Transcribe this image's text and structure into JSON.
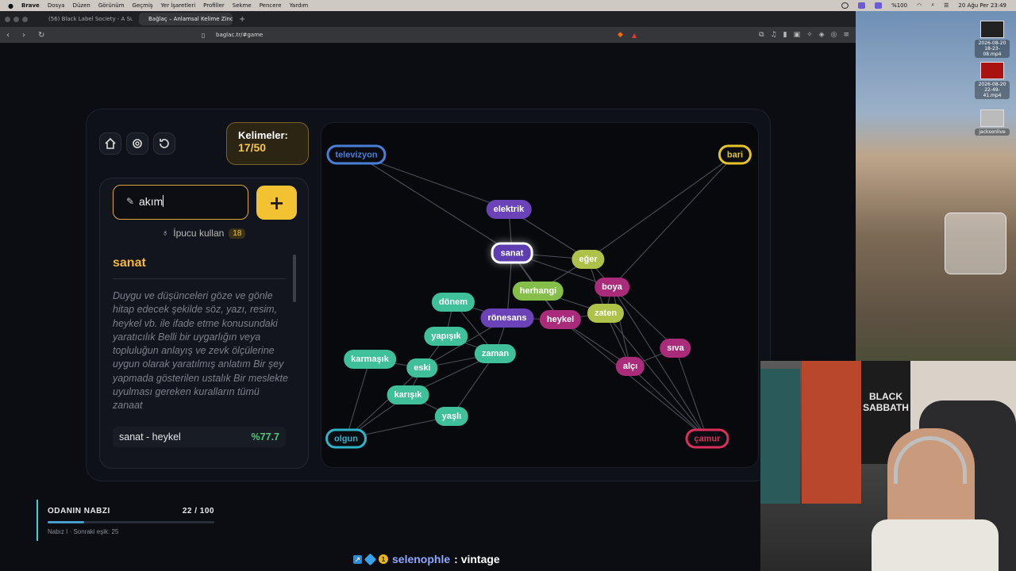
{
  "menubar": {
    "app": "Brave",
    "items": [
      "Dosya",
      "Düzen",
      "Görünüm",
      "Geçmiş",
      "Yer İşaretleri",
      "Profiller",
      "Sekme",
      "Pencere",
      "Yardım"
    ],
    "battery": "%100",
    "datetime": "20 Ağu Per  23:49"
  },
  "browser": {
    "tabs": [
      {
        "label": "(56) Black Label Society - A Su"
      },
      {
        "label": "Bağlaç – Anlamsal Kelime Zinc"
      }
    ],
    "url": "baglac.tr/#game"
  },
  "desktop": {
    "files": [
      {
        "label": "2026-08-20\n18-23-08.mp4"
      },
      {
        "label": "2026-08-20\n22-49-41.mp4"
      },
      {
        "label": "jacksonlive"
      }
    ]
  },
  "game": {
    "counter": {
      "title": "Kelimeler:",
      "value": "17/50"
    },
    "input": {
      "value": "akım"
    },
    "hint": {
      "label": "İpucu kullan",
      "count": "18"
    },
    "definition": {
      "word": "sanat",
      "text": "Duygu ve düşünceleri göze ve gönle hitap edecek şekilde söz, yazı, resim, heykel vb. ile ifade etme konusundaki yaratıcılık Belli bir uygarlığın veya topluluğun anlayış ve zevk ölçülerine uygun olarak yaratılmış anlatım Bir şey yapmada gösterilen ustalık Bir meslekte uyulması gereken kuralların tümü zanaat"
    },
    "similarity": {
      "pair": "sanat - heykel",
      "value": "%77.7"
    },
    "graph": {
      "anchors": [
        {
          "id": "televizyon",
          "label": "televizyon",
          "color": "#4a7fd8"
        },
        {
          "id": "bari",
          "label": "bari",
          "color": "#e6c32a"
        },
        {
          "id": "olgun",
          "label": "olgun",
          "color": "#2fb3c8"
        },
        {
          "id": "camur",
          "label": "çamur",
          "color": "#d8305a"
        }
      ],
      "nodes": [
        {
          "id": "elektrik",
          "label": "elektrik",
          "cls": "purple"
        },
        {
          "id": "sanat",
          "label": "sanat",
          "cls": "sel"
        },
        {
          "id": "eger",
          "label": "eğer",
          "cls": "ygreen"
        },
        {
          "id": "herhangi",
          "label": "herhangi",
          "cls": "lgreen"
        },
        {
          "id": "boya",
          "label": "boya",
          "cls": "magenta"
        },
        {
          "id": "donem",
          "label": "dönem",
          "cls": "teal"
        },
        {
          "id": "ronesans",
          "label": "rönesans",
          "cls": "purple"
        },
        {
          "id": "heykel",
          "label": "heykel",
          "cls": "magenta"
        },
        {
          "id": "zaten",
          "label": "zaten",
          "cls": "ygreen"
        },
        {
          "id": "sıva",
          "label": "sıva",
          "cls": "magenta"
        },
        {
          "id": "yapisik",
          "label": "yapışık",
          "cls": "teal"
        },
        {
          "id": "zaman",
          "label": "zaman",
          "cls": "teal"
        },
        {
          "id": "karmasik",
          "label": "karmaşık",
          "cls": "teal"
        },
        {
          "id": "eski",
          "label": "eski",
          "cls": "teal"
        },
        {
          "id": "alci",
          "label": "alçı",
          "cls": "magenta"
        },
        {
          "id": "karisik",
          "label": "karışık",
          "cls": "teal"
        },
        {
          "id": "yasli",
          "label": "yaşlı",
          "cls": "teal"
        }
      ],
      "edges": [
        [
          "televizyon",
          "elektrik"
        ],
        [
          "televizyon",
          "sanat"
        ],
        [
          "elektrik",
          "sanat"
        ],
        [
          "elektrik",
          "eger"
        ],
        [
          "sanat",
          "eger"
        ],
        [
          "sanat",
          "herhangi"
        ],
        [
          "sanat",
          "boya"
        ],
        [
          "sanat",
          "ronesans"
        ],
        [
          "sanat",
          "heykel"
        ],
        [
          "bari",
          "eger"
        ],
        [
          "bari",
          "boya"
        ],
        [
          "eger",
          "boya"
        ],
        [
          "eger",
          "zaten"
        ],
        [
          "eger",
          "herhangi"
        ],
        [
          "herhangi",
          "heykel"
        ],
        [
          "herhangi",
          "zaten"
        ],
        [
          "boya",
          "zaten"
        ],
        [
          "boya",
          "alci"
        ],
        [
          "boya",
          "sıva"
        ],
        [
          "heykel",
          "zaten"
        ],
        [
          "heykel",
          "alci"
        ],
        [
          "heykel",
          "ronesans"
        ],
        [
          "heykel",
          "camur"
        ],
        [
          "zaten",
          "alci"
        ],
        [
          "alci",
          "sıva"
        ],
        [
          "alci",
          "camur"
        ],
        [
          "sıva",
          "camur"
        ],
        [
          "ronesans",
          "donem"
        ],
        [
          "ronesans",
          "zaman"
        ],
        [
          "donem",
          "zaman"
        ],
        [
          "donem",
          "yapisik"
        ],
        [
          "yapisik",
          "eski"
        ],
        [
          "yapisik",
          "zaman"
        ],
        [
          "zaman",
          "eski"
        ],
        [
          "zaman",
          "karisik"
        ],
        [
          "zaman",
          "yasli"
        ],
        [
          "eski",
          "karisik"
        ],
        [
          "karmasik",
          "eski"
        ],
        [
          "karmasik",
          "olgun"
        ],
        [
          "karisik",
          "olgun"
        ],
        [
          "karisik",
          "yasli"
        ],
        [
          "yasli",
          "olgun"
        ],
        [
          "eski",
          "olgun"
        ],
        [
          "ronesans",
          "eski"
        ],
        [
          "zaten",
          "camur"
        ],
        [
          "boya",
          "camur"
        ]
      ]
    }
  },
  "pulse": {
    "title": "ODANIN NABZI",
    "value": "22 / 100",
    "level": 0.22,
    "sub": "Nabız I · Sonraki eşik: 25"
  },
  "ticker": {
    "user": "selenophle",
    "message": ": vintage"
  },
  "webcam": {
    "poster_text": "BLACK\nSABBATH"
  }
}
